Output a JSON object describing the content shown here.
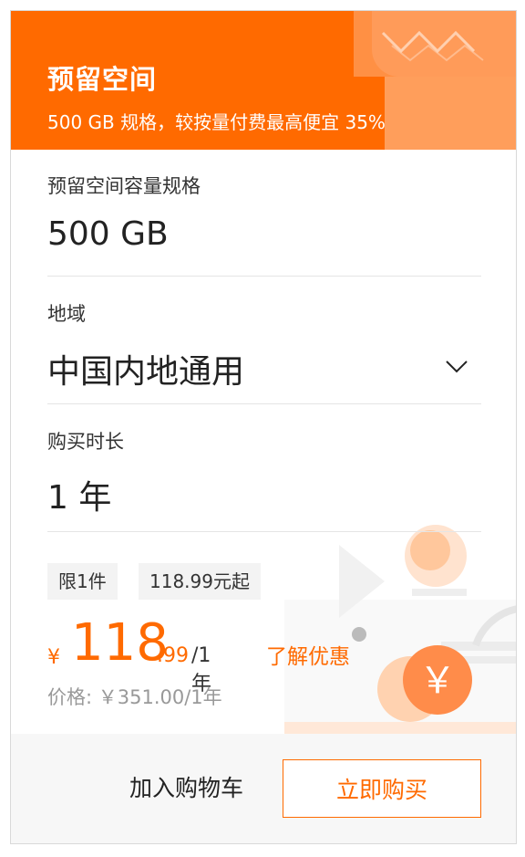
{
  "banner": {
    "title": "预留空间",
    "subtitle": "500 GB 规格，较按量付费最高便宜 35%"
  },
  "capacity": {
    "label": "预留空间容量规格",
    "value": "500 GB"
  },
  "region": {
    "label": "地域",
    "value": "中国内地通用"
  },
  "duration": {
    "label": "购买时长",
    "value": "1 年"
  },
  "tags": {
    "limit": "限1件",
    "from_price": "118.99元起"
  },
  "price": {
    "currency": "¥",
    "integer": "118",
    "decimal": ".99",
    "unit": "/1年",
    "discount_link": "了解优惠",
    "original": "价格: ￥351.00/1年"
  },
  "footer": {
    "cart_label": "加入购物车",
    "buy_label": "立即购买"
  },
  "colors": {
    "accent": "#ff6a00",
    "banner_bg": "#ff6a00",
    "footer_bg": "#f7f7f7"
  }
}
